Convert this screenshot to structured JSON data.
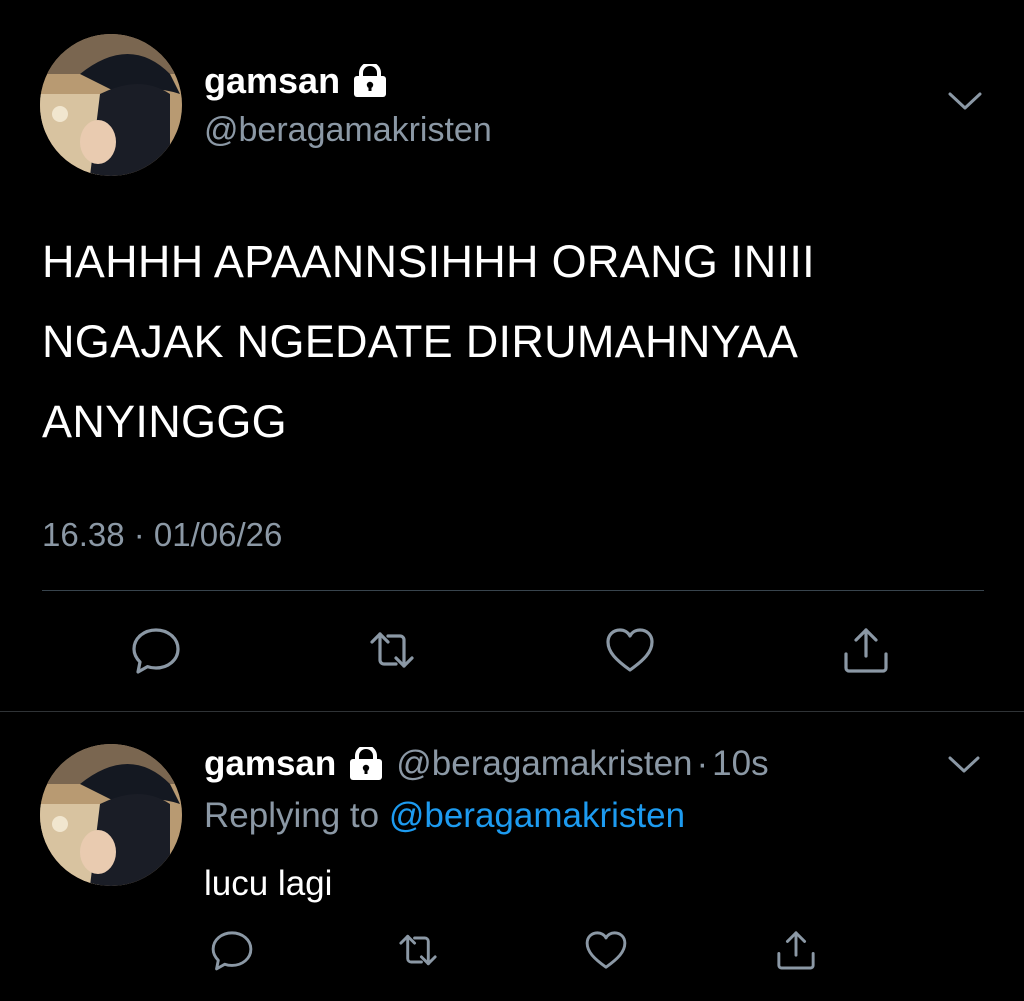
{
  "main_tweet": {
    "display_name": "gamsan",
    "handle": "@beragamakristen",
    "text_lines": [
      "HAHHH APAANNSIHHH ORANG INIII",
      "NGAJAK NGEDATE DIRUMAHNYAA",
      "ANYINGGG"
    ],
    "timestamp": "16.38 · 01/06/26"
  },
  "reply_tweet": {
    "display_name": "gamsan",
    "handle": "@beragamakristen",
    "separator": "·",
    "time_ago": "10s",
    "replying_prefix": "Replying to",
    "replying_to": "@beragamakristen",
    "text": "lucu lagi"
  },
  "icons": [
    "lock-icon",
    "chevron-down-icon",
    "reply-icon",
    "retweet-icon",
    "like-icon",
    "share-icon"
  ],
  "colors": {
    "background": "#000000",
    "text": "#ffffff",
    "secondary_text": "#8b98a5",
    "link": "#1d9bf0",
    "divider": "#38444d"
  }
}
